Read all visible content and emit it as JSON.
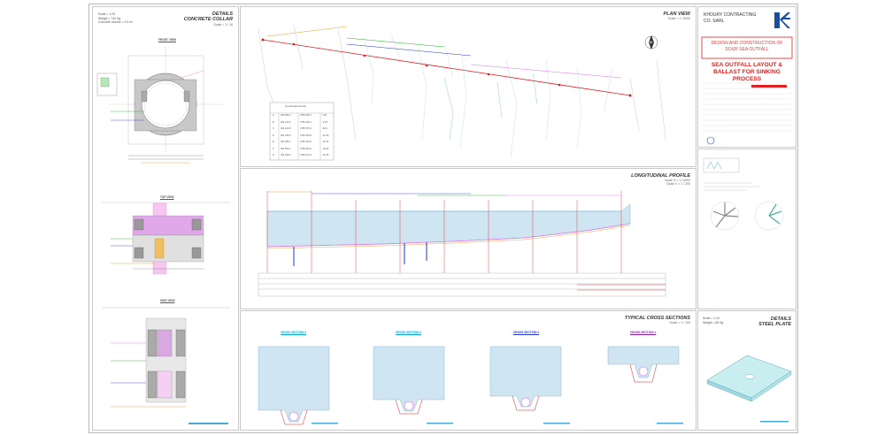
{
  "details_collar": {
    "title": "DETAILS",
    "subtitle": "CONCRETE COLLAR",
    "scale": "Scale = 1 / 10",
    "info": [
      "Scale = 1:20",
      "Weight = 740 Kg",
      "Concrete volume = 0.3 m³"
    ],
    "front_view": "FRONT VIEW",
    "top_view": "TOP VIEW",
    "side_view": "SIDE VIEW"
  },
  "plan_view": {
    "title": "PLAN VIEW",
    "scale": "Scale = 1 / 5000",
    "north": "N",
    "table_title": "Coordinate Points",
    "table_rows": [
      [
        "A",
        "360 950.2",
        "3765 420.7",
        "1.60"
      ],
      [
        "B",
        "361 010.5",
        "3765 402.1",
        "-3.25"
      ],
      [
        "C",
        "361 120.8",
        "3765 370.4",
        "-8.10"
      ],
      [
        "D",
        "361 245.3",
        "3765 332.9",
        "-12.40"
      ],
      [
        "E",
        "361 380.7",
        "3765 291.6",
        "-15.75"
      ],
      [
        "F",
        "361 502.1",
        "3765 254.0",
        "-18.30"
      ],
      [
        "G",
        "361 640.9",
        "3765 212.3",
        "-21.05"
      ]
    ]
  },
  "title_block": {
    "company": "KHOURY CONTRACTING",
    "company2": "CO. SARL",
    "project": "DESIGN AND CONSTRUCTION OF SOUR SEA OUTFALL",
    "drawing_title_1": "SEA OUTFALL LAYOUT &",
    "drawing_title_2": "BALLAST FOR SINKING PROCESS"
  },
  "longitudinal_profile": {
    "title": "LONGITUDINAL PROFILE",
    "scale_h": "Scale H = 1 / 5000",
    "scale_v": "Scale V = 1 / 200"
  },
  "cross_sections": {
    "title": "TYPICAL CROSS SECTIONS",
    "scale": "Scale = 1 / 100",
    "labels": [
      "CROSS SECTION 4",
      "CROSS SECTION 3",
      "CROSS SECTION 2",
      "CROSS SECTION 1"
    ]
  },
  "steel_plate": {
    "title": "DETAILS",
    "subtitle": "STEEL PLATE",
    "info": [
      "Scale = 1:10",
      "Weight = 80 Kg"
    ]
  },
  "colors": {
    "blue_water": "#cfe6f2",
    "red": "#e02020",
    "magenta": "#e070e0"
  }
}
